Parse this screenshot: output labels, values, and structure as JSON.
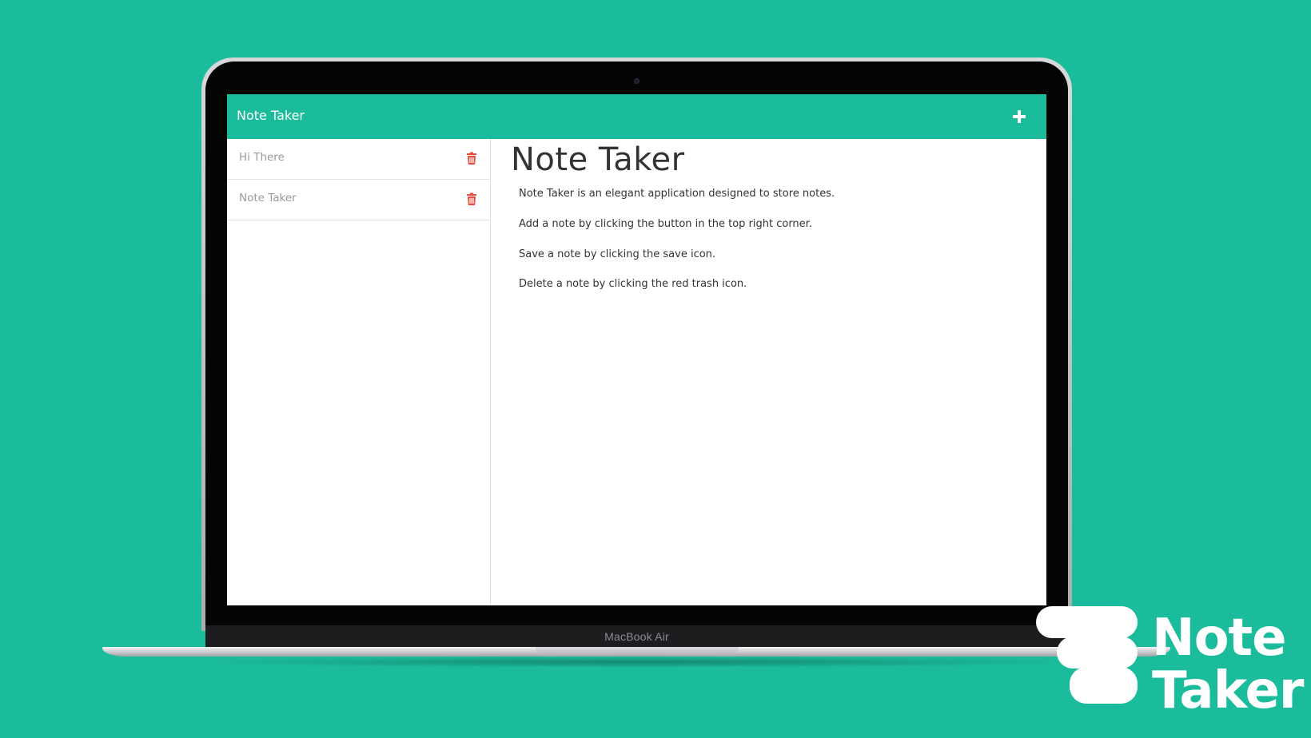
{
  "app": {
    "nav_title": "Note Taker",
    "add_icon": "plus-icon"
  },
  "notes": [
    {
      "title": "Hi There",
      "icon": "trash-icon",
      "icon_color": "#e74c3c"
    },
    {
      "title": "Note Taker",
      "icon": "trash-icon",
      "icon_color": "#e74c3c"
    }
  ],
  "main": {
    "title": "Note Taker",
    "lines": [
      "Note Taker is an elegant application designed to store notes.",
      "Add a note by clicking the button in the top right corner.",
      "Save a note by clicking the save icon.",
      "Delete a note by clicking the red trash icon."
    ]
  },
  "device": {
    "label": "MacBook Air"
  },
  "logo": {
    "line1": "Note",
    "line2": "Taker"
  },
  "colors": {
    "background": "#1bbc9b",
    "navbar": "#1bbc9b",
    "trash": "#e74c3c"
  }
}
